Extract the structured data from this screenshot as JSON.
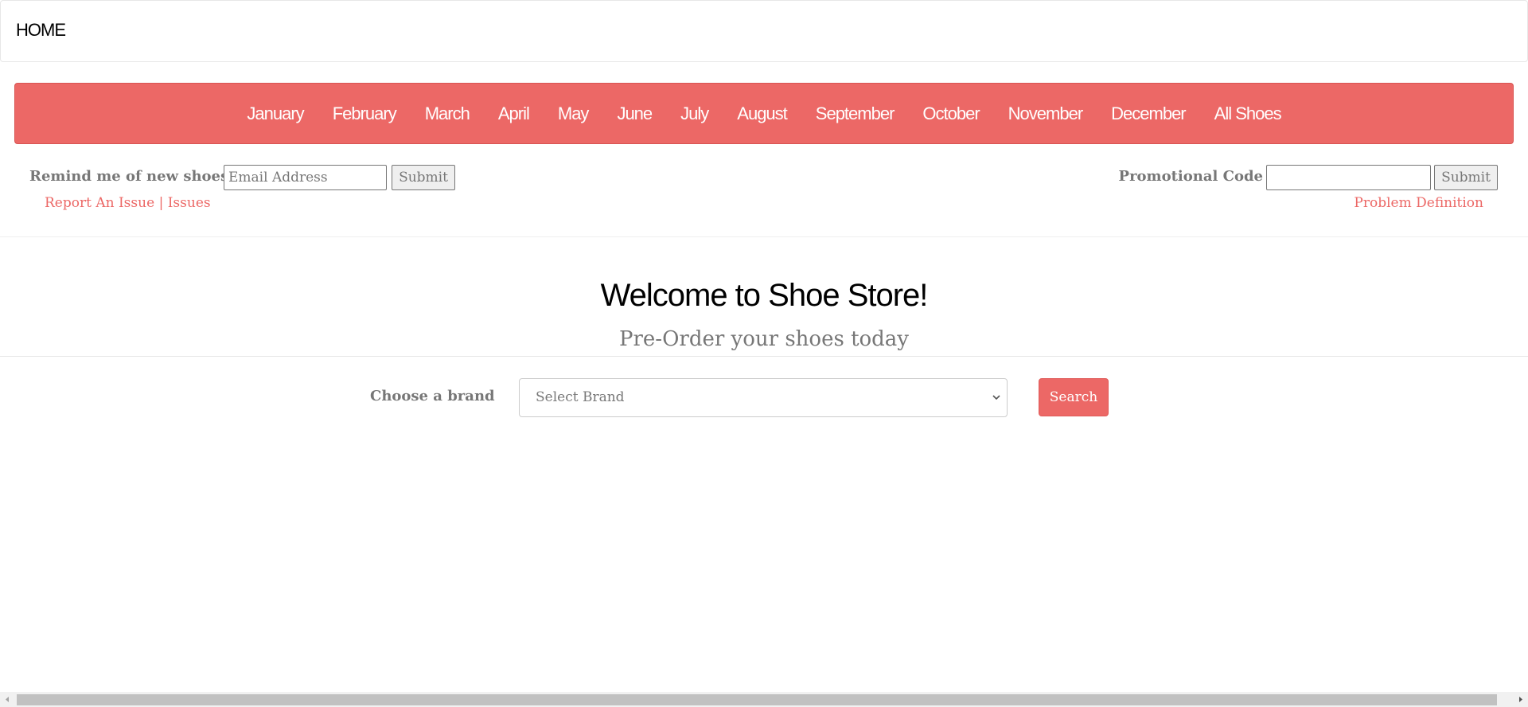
{
  "nav": {
    "home_label": "HOME"
  },
  "months": [
    "January",
    "February",
    "March",
    "April",
    "May",
    "June",
    "July",
    "August",
    "September",
    "October",
    "November",
    "December",
    "All Shoes"
  ],
  "remind": {
    "label": "Remind me of new shoes",
    "email_placeholder": "Email Address",
    "submit_label": "Submit"
  },
  "promo": {
    "label": "Promotional Code",
    "value": "",
    "submit_label": "Submit"
  },
  "links": {
    "report_issue": "Report An Issue",
    "separator": "|",
    "issues": "Issues",
    "problem_definition": "Problem Definition"
  },
  "hero": {
    "title": "Welcome to Shoe Store!",
    "subtitle": "Pre-Order your shoes today"
  },
  "brand_search": {
    "label": "Choose a brand",
    "selected": "Select Brand",
    "search_label": "Search"
  },
  "colors": {
    "accent": "#ec6866",
    "muted_text": "#777777"
  }
}
